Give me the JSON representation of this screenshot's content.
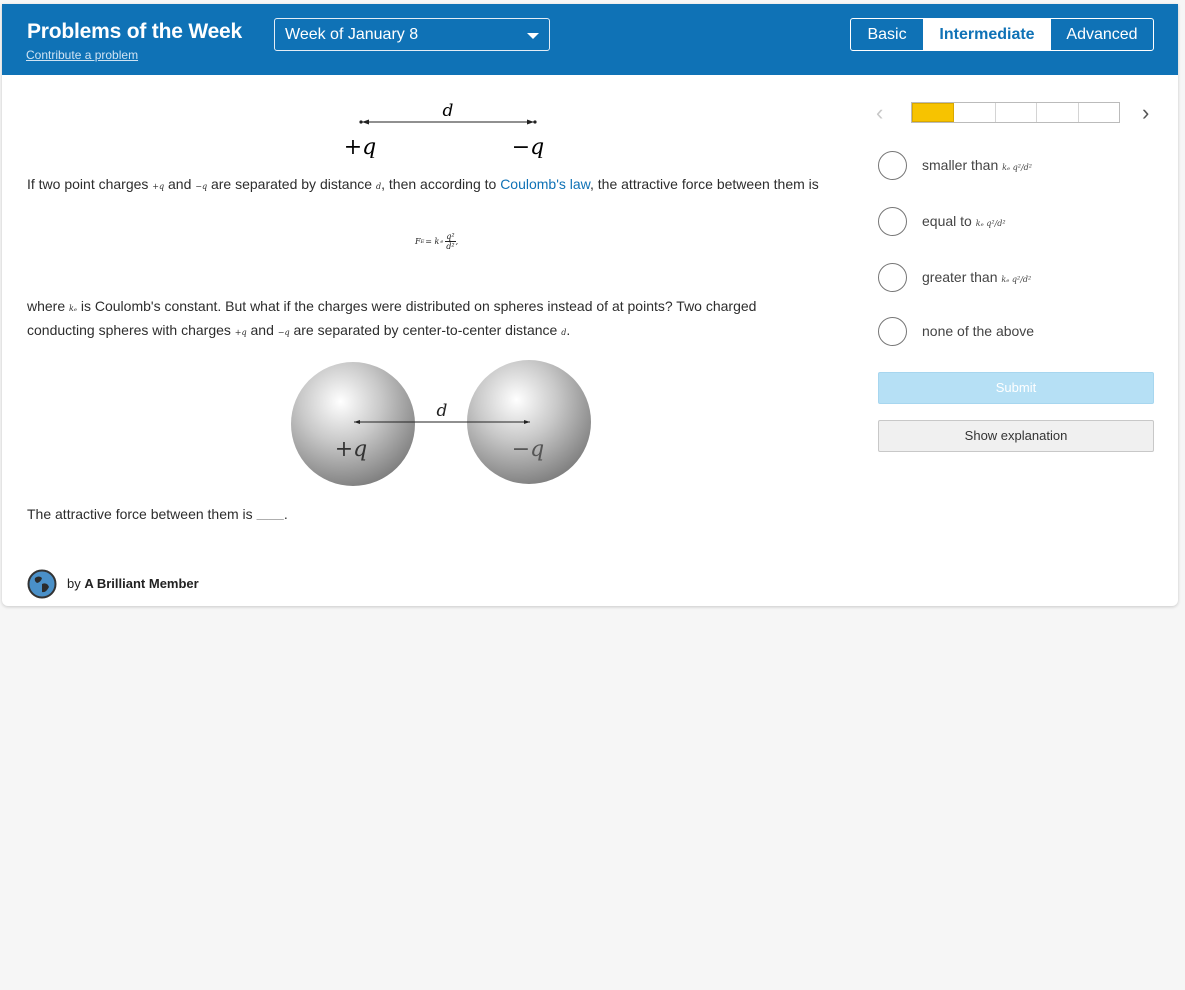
{
  "header": {
    "title": "Problems of the Week",
    "contribute_link": "Contribute a problem",
    "week_selector": {
      "selected": "Week of January 8"
    },
    "levels": [
      {
        "label": "Basic",
        "active": false
      },
      {
        "label": "Intermediate",
        "active": true
      },
      {
        "label": "Advanced",
        "active": false
      }
    ]
  },
  "problem": {
    "figure1": {
      "distance_label": "d",
      "left_charge": "+q",
      "right_charge": "−q"
    },
    "para1": {
      "t1": "If two point charges ",
      "m1": "+q",
      "t2": " and ",
      "m2": "−q",
      "t3": " are separated by distance ",
      "m3": "d",
      "t4": ", then according to ",
      "link": "Coulomb's law",
      "t5": ", the attractive force between them is"
    },
    "formula": {
      "lhs": "F",
      "lhs_sub": "E",
      "eq": " = k",
      "k_sub": "e",
      "num": "q²",
      "den": "d²",
      "tail": ","
    },
    "para2": {
      "line1_t1": "where ",
      "line1_m1": "kₑ",
      "line1_t2": " is Coulomb's constant. But what if the charges were distributed on spheres instead of at points? Two charged",
      "line2_t1": "conducting spheres with charges ",
      "line2_m1": "+q",
      "line2_t2": " and ",
      "line2_m2": "−q",
      "line2_t3": " are separated by center-to-center distance ",
      "line2_m3": "d",
      "line2_t4": "."
    },
    "figure2": {
      "distance_label": "d",
      "left_charge": "+q",
      "right_charge": "−q"
    },
    "question": {
      "text": "The attractive force between them is ",
      "blank": "_______",
      "end": "."
    },
    "author": {
      "by": "by ",
      "name": "A Brilliant Member"
    }
  },
  "answers": {
    "progress": {
      "completed": 1,
      "total": 5
    },
    "choices": [
      {
        "label": "smaller than ",
        "expr": "kₑ q²/d²"
      },
      {
        "label": "equal to ",
        "expr": "kₑ q²/d²"
      },
      {
        "label": "greater than ",
        "expr": "kₑ q²/d²"
      },
      {
        "label": "none of the above",
        "expr": ""
      }
    ],
    "submit_label": "Submit",
    "explanation_label": "Show explanation"
  },
  "colors": {
    "header_bg": "#0f72b6",
    "link": "#0f72b6",
    "progress_fill": "#f7c300",
    "submit_bg": "#b6e0f5"
  }
}
